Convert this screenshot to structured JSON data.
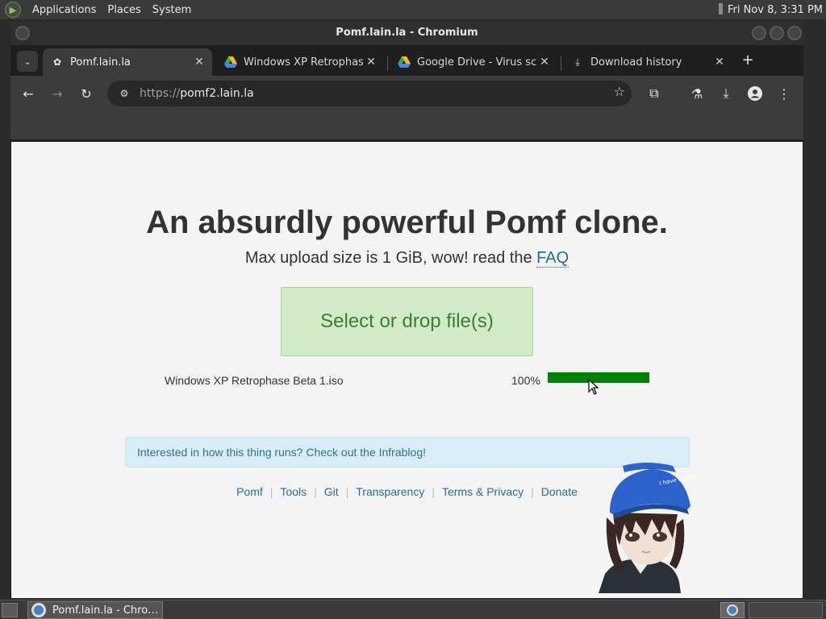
{
  "top_panel": {
    "menus": [
      "Applications",
      "Places",
      "System"
    ],
    "clock": "Fri Nov  8,  3:31 PM"
  },
  "window": {
    "title": "Pomf.lain.la - Chromium"
  },
  "tabs": [
    {
      "label": "Pomf.lain.la",
      "favicon": "pomf-favicon-icon",
      "active": true
    },
    {
      "label": "Windows XP Retrophase",
      "favicon": "google-drive-icon",
      "active": false
    },
    {
      "label": "Google Drive - Virus scan",
      "favicon": "google-drive-icon",
      "active": false
    },
    {
      "label": "Download history",
      "favicon": "download-icon",
      "active": false
    }
  ],
  "toolbar": {
    "url_scheme": "https://",
    "url_host": "pomf2.lain.la"
  },
  "page": {
    "headline": "An absurdly powerful Pomf clone.",
    "subline_text": "Max upload size is 1 GiB, wow! read the ",
    "subline_link": "FAQ",
    "dropzone_label": "Select or drop file(s)",
    "upload": {
      "filename": "Windows XP Retrophase Beta 1.iso",
      "percent_label": "100%",
      "progress": 1.0,
      "bar_color": "#008000"
    },
    "alert_text": "Interested in how this thing runs? Check out the Infrablog!",
    "footer_links": [
      "Pomf",
      "Tools",
      "Git",
      "Transparency",
      "Terms & Privacy",
      "Donate"
    ]
  },
  "taskbar": {
    "task_label": "Pomf.lain.la - Chro…"
  },
  "colors": {
    "page_bg": "#f4f4f4",
    "dropzone_bg": "#d2ebc7",
    "dropzone_text": "#3f7a3a",
    "alert_bg": "#d9edf7",
    "link": "#2a6b9b"
  }
}
